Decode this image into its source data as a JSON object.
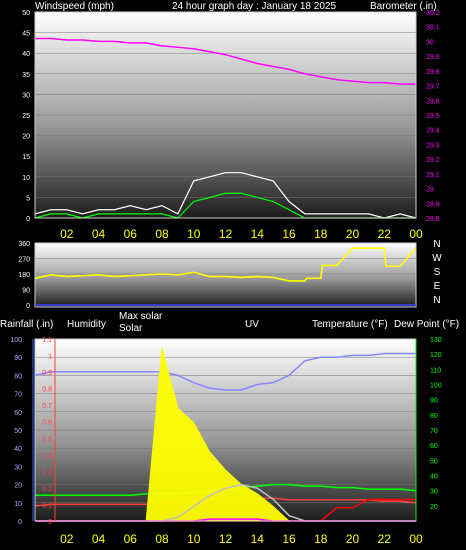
{
  "header": {
    "windspeed_label": "Windspeed (mph)",
    "title": "24 hour graph day : January 18 2025",
    "barometer_label": "Barometer (.in)"
  },
  "middle_header": {
    "rainfall_label": "Rainfall (.in)",
    "humidity_label": "Humidity",
    "max_solar_label": "Max solar",
    "solar_label": "Solar",
    "uv_label": "UV",
    "temperature_label": "Temperature (°F)",
    "dewpoint_label": "Dew Point (°F)"
  },
  "x_ticks": [
    "02",
    "04",
    "06",
    "08",
    "10",
    "12",
    "14",
    "16",
    "18",
    "20",
    "22",
    "00"
  ],
  "direction_labels": [
    "N",
    "W",
    "S",
    "E",
    "N"
  ],
  "chart_data": [
    {
      "type": "line",
      "title": "24 hour graph day : January 18 2025",
      "ylabel": "Windspeed (mph)",
      "ylim": [
        0,
        50
      ],
      "y_ticks": [
        "0",
        "5",
        "10",
        "15",
        "20",
        "25",
        "30",
        "35",
        "40",
        "45",
        "50"
      ],
      "y2label": "Barometer (.in)",
      "y2lim": [
        28.8,
        30.2
      ],
      "y2_ticks": [
        "28.8",
        "28.9",
        "29",
        "29.1",
        "29.2",
        "29.3",
        "29.4",
        "29.5",
        "29.6",
        "29.7",
        "29.8",
        "29.9",
        "30",
        "30.1",
        "30.2"
      ],
      "x": [
        0,
        1,
        2,
        3,
        4,
        5,
        6,
        7,
        8,
        9,
        10,
        11,
        12,
        13,
        14,
        15,
        16,
        17,
        18,
        19,
        20,
        21,
        22,
        23,
        24
      ],
      "series": [
        {
          "name": "Windspeed (mph)",
          "color": "#ffffff",
          "axis": "y",
          "values": [
            1,
            2,
            2,
            1,
            2,
            2,
            3,
            2,
            3,
            1,
            9,
            10,
            11,
            11,
            10,
            9,
            4,
            1,
            1,
            1,
            1,
            1,
            0,
            1,
            0
          ]
        },
        {
          "name": "",
          "color": "#00ff00",
          "axis": "y",
          "values": [
            0,
            1,
            1,
            0,
            1,
            1,
            1,
            1,
            1,
            0,
            4,
            5,
            6,
            6,
            5,
            4,
            2,
            0,
            0,
            0,
            0,
            0,
            0,
            0,
            0
          ]
        },
        {
          "name": "Barometer (.in)",
          "color": "#ff00ff",
          "axis": "y2",
          "values": [
            30.02,
            30.02,
            30.01,
            30.01,
            30.0,
            30.0,
            29.99,
            29.99,
            29.97,
            29.96,
            29.95,
            29.93,
            29.91,
            29.88,
            29.85,
            29.83,
            29.81,
            29.78,
            29.76,
            29.74,
            29.73,
            29.72,
            29.72,
            29.71,
            29.71
          ]
        }
      ]
    },
    {
      "type": "line",
      "ylim": [
        0,
        360
      ],
      "y_ticks": [
        "0",
        "90",
        "180",
        "270",
        "360"
      ],
      "x": [
        0,
        1,
        2,
        3,
        4,
        5,
        6,
        7,
        8,
        9,
        10,
        11,
        12,
        13,
        14,
        15,
        16,
        17,
        17.1,
        18,
        18.1,
        19,
        20,
        21,
        22,
        22.1,
        23,
        24
      ],
      "series": [
        {
          "name": "",
          "color": "#ffff00",
          "values": [
            155,
            175,
            165,
            170,
            175,
            165,
            170,
            175,
            180,
            175,
            190,
            165,
            165,
            160,
            165,
            160,
            140,
            140,
            155,
            155,
            230,
            230,
            330,
            330,
            330,
            225,
            225,
            330
          ]
        }
      ]
    },
    {
      "type": "line",
      "ylim": [
        0,
        100
      ],
      "y_ticks": [
        "0",
        "10",
        "20",
        "30",
        "40",
        "50",
        "60",
        "70",
        "80",
        "90",
        "100"
      ],
      "rain_ticks": [
        "0",
        "0.1",
        "0.2",
        "0.3",
        "0.4",
        "0.5",
        "0.6",
        "0.7",
        "0.8",
        "0.9",
        "1",
        "1.1"
      ],
      "y2lim": [
        10,
        130
      ],
      "y2_ticks": [
        "20",
        "30",
        "40",
        "50",
        "60",
        "70",
        "80",
        "90",
        "100",
        "110",
        "120",
        "130"
      ],
      "x": [
        0,
        1,
        2,
        3,
        4,
        5,
        6,
        7,
        8,
        9,
        10,
        11,
        12,
        13,
        14,
        15,
        16,
        17,
        18,
        19,
        20,
        21,
        22,
        23,
        24
      ],
      "series": [
        {
          "name": "Humidity",
          "color": "#8888ff",
          "axis": "y",
          "values": [
            80,
            82,
            82,
            82,
            82,
            82,
            82,
            82,
            82,
            80,
            76,
            73,
            72,
            72,
            75,
            76,
            80,
            88,
            90,
            90,
            91,
            91,
            92,
            92,
            92
          ]
        },
        {
          "name": "Temperature (°F)",
          "color": "#00ff00",
          "axis": "y2",
          "values": [
            27,
            27,
            27,
            27,
            27,
            27,
            27,
            28,
            28,
            28,
            29,
            30,
            31,
            32,
            33,
            34,
            34,
            33,
            33,
            32,
            32,
            31,
            31,
            31,
            30
          ]
        },
        {
          "name": "Dew Point (°F)",
          "color": "#ff4040",
          "axis": "y2",
          "values": [
            20,
            21,
            21,
            21,
            21,
            21,
            21,
            21,
            22,
            22,
            23,
            24,
            25,
            25,
            25,
            25,
            24,
            24,
            24,
            24,
            24,
            24,
            23,
            23,
            22
          ]
        },
        {
          "name": "Rainfall (.in)",
          "color": "#ff0000",
          "axis": "rain",
          "values": [
            0,
            0,
            0,
            0,
            0,
            0,
            0,
            0,
            0,
            0,
            0,
            0,
            0,
            0,
            0,
            0,
            0,
            0,
            0,
            0.08,
            0.08,
            0.13,
            0.13,
            0.13,
            0.13
          ]
        },
        {
          "name": "Solar",
          "color": "#ffff00",
          "axis": "y",
          "values": [
            0,
            0,
            0,
            0,
            0,
            0,
            0,
            0,
            95,
            62,
            54,
            38,
            28,
            20,
            15,
            8,
            0,
            0,
            0,
            0,
            0,
            0,
            0,
            0,
            0
          ]
        },
        {
          "name": "Max solar",
          "color": "#c0c0c0",
          "axis": "y",
          "values": [
            0,
            0,
            0,
            0,
            0,
            0,
            0,
            0,
            0,
            2,
            8,
            14,
            18,
            20,
            18,
            12,
            3,
            0,
            0,
            0,
            0,
            0,
            0,
            0,
            0
          ]
        },
        {
          "name": "UV",
          "color": "#ff00ff",
          "axis": "y",
          "values": [
            0,
            0,
            0,
            0,
            0,
            0,
            0,
            0,
            0,
            0,
            0,
            1,
            1,
            1,
            1,
            0,
            0,
            0,
            0,
            0,
            0,
            0,
            0,
            0,
            0
          ]
        }
      ]
    }
  ]
}
